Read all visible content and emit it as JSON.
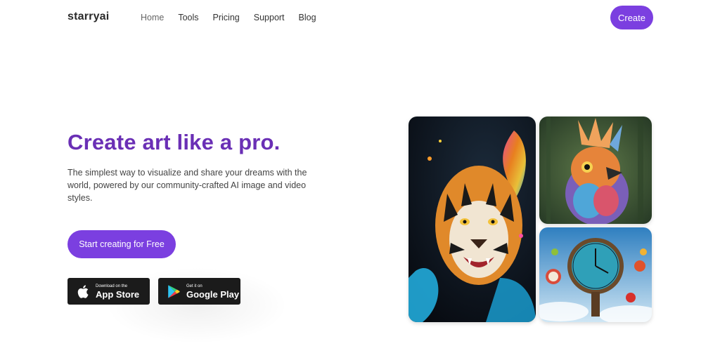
{
  "header": {
    "logo": "starryai",
    "nav": [
      {
        "label": "Home"
      },
      {
        "label": "Tools"
      },
      {
        "label": "Pricing"
      },
      {
        "label": "Support"
      },
      {
        "label": "Blog"
      }
    ],
    "create_label": "Create"
  },
  "hero": {
    "headline": "Create art like a pro.",
    "subhead": "The simplest way to visualize and share your dreams with the world, powered by our community-crafted AI image and video styles.",
    "cta_label": "Start creating for Free"
  },
  "stores": {
    "apple": {
      "small": "Download on the",
      "big": "App Store",
      "icon": "apple-icon"
    },
    "google": {
      "small": "Get it on",
      "big": "Google Play",
      "icon": "google-play-icon"
    }
  },
  "colors": {
    "accent": "#7b3fe0",
    "headline": "#6a2fb5",
    "store_bg": "#1b1b1b"
  },
  "gallery": [
    {
      "name": "tiger-artwork"
    },
    {
      "name": "bird-artwork"
    },
    {
      "name": "clock-artwork"
    }
  ]
}
